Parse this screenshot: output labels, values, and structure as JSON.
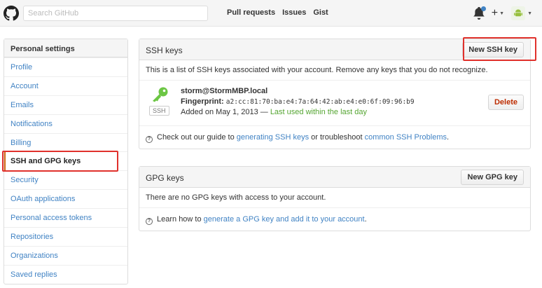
{
  "header": {
    "search_placeholder": "Search GitHub",
    "nav": [
      "Pull requests",
      "Issues",
      "Gist"
    ],
    "icons": {
      "logo": "github-octocat-icon",
      "bell": "bell-icon",
      "plus": "plus-icon",
      "avatar": "android-avatar-icon"
    },
    "plus_label": "+"
  },
  "sidebar": {
    "heading": "Personal settings",
    "items": [
      {
        "label": "Profile"
      },
      {
        "label": "Account"
      },
      {
        "label": "Emails"
      },
      {
        "label": "Notifications"
      },
      {
        "label": "Billing"
      },
      {
        "label": "SSH and GPG keys",
        "selected": true
      },
      {
        "label": "Security"
      },
      {
        "label": "OAuth applications"
      },
      {
        "label": "Personal access tokens"
      },
      {
        "label": "Repositories"
      },
      {
        "label": "Organizations"
      },
      {
        "label": "Saved replies"
      }
    ]
  },
  "ssh": {
    "title": "SSH keys",
    "new_button": "New SSH key",
    "description": "This is a list of SSH keys associated with your account. Remove any keys that you do not recognize.",
    "key": {
      "name": "storm@StormMBP.local",
      "fingerprint_label": "Fingerprint:",
      "fingerprint": "a2:cc:81:70:ba:e4:7a:64:42:ab:e4:e0:6f:09:96:b9",
      "added": "Added on May 1, 2013 —",
      "last_used": "Last used within the last day",
      "badge": "SSH",
      "delete_button": "Delete"
    },
    "help_prefix": "Check out our guide to",
    "help_link1": "generating SSH keys",
    "help_middle": "or troubleshoot",
    "help_link2": "common SSH Problems",
    "help_suffix": "."
  },
  "gpg": {
    "title": "GPG keys",
    "new_button": "New GPG key",
    "empty": "There are no GPG keys with access to your account.",
    "help_prefix": "Learn how to",
    "help_link": "generate a GPG key and add it to your account",
    "help_suffix": "."
  },
  "colors": {
    "link": "#4183c4",
    "highlight": "#e0312c",
    "key_green": "#6cc644",
    "success": "#55a532",
    "danger": "#bd2c00"
  }
}
